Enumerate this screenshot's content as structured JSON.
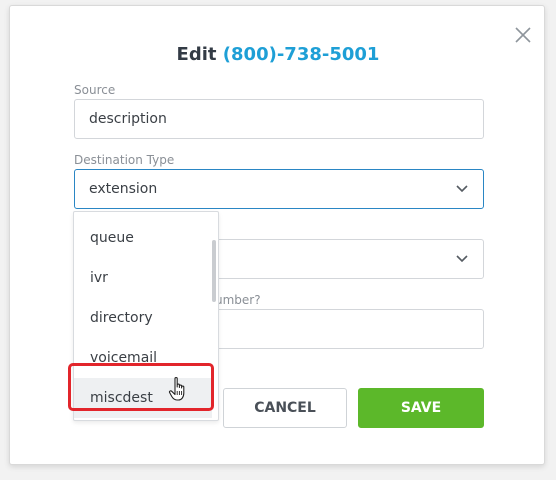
{
  "dialog": {
    "title_prefix": "Edit",
    "title_phone": "(800)-738-5001",
    "close_icon": "close-icon"
  },
  "source": {
    "label": "Source",
    "value": "description"
  },
  "destination_type": {
    "label": "Destination Type",
    "value": "extension"
  },
  "partial_label": {
    "text": "umber?"
  },
  "dropdown": {
    "options": [
      "queue",
      "ivr",
      "directory",
      "voicemail",
      "miscdest"
    ],
    "hovered": "miscdest"
  },
  "buttons": {
    "cancel": "CANCEL",
    "save": "SAVE"
  },
  "colors": {
    "accent": "#1e9fd6",
    "save": "#5cb82a",
    "highlight": "#e2252b"
  }
}
